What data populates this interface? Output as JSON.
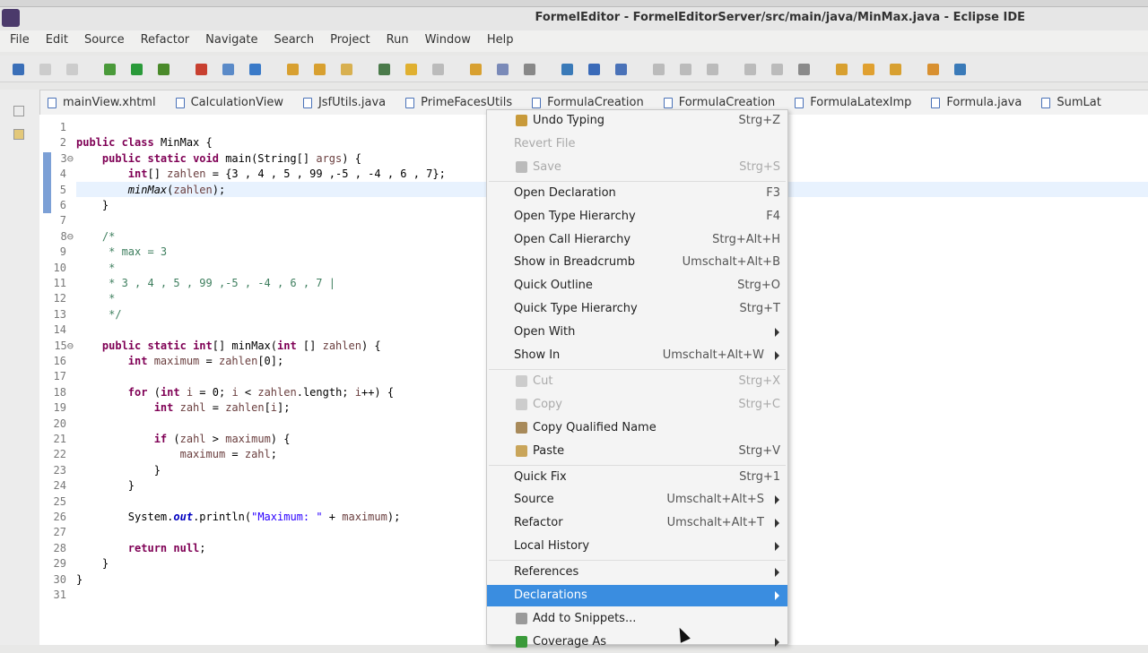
{
  "window": {
    "title": "FormelEditor - FormelEditorServer/src/main/java/MinMax.java - Eclipse IDE"
  },
  "menubar": [
    "File",
    "Edit",
    "Source",
    "Refactor",
    "Navigate",
    "Search",
    "Project",
    "Run",
    "Window",
    "Help"
  ],
  "tabs": [
    "mainView.xhtml",
    "CalculationView",
    "JsfUtils.java",
    "PrimeFacesUtils",
    "FormulaCreation",
    "FormulaCreation",
    "FormulaLatexImp",
    "Formula.java",
    "SumLat"
  ],
  "code": [
    [],
    [
      [
        "kw",
        "public "
      ],
      [
        "kw",
        "class "
      ],
      [
        "",
        "MinMax {"
      ]
    ],
    [
      [
        "",
        "    "
      ],
      [
        "kw",
        "public "
      ],
      [
        "kw",
        "static "
      ],
      [
        "kw",
        "void "
      ],
      [
        "",
        "main(String[] "
      ],
      [
        "var",
        "args"
      ],
      [
        "",
        ") {"
      ]
    ],
    [
      [
        "",
        "        "
      ],
      [
        "kw",
        "int"
      ],
      [
        "",
        "[] "
      ],
      [
        "var",
        "zahlen"
      ],
      [
        "",
        " = {3 , 4 , 5 , 99 ,-5 , -4 , 6 , 7};"
      ]
    ],
    [
      [
        "",
        "        "
      ],
      [
        "it",
        "minMax"
      ],
      [
        "",
        "("
      ],
      [
        "var",
        "zahlen"
      ],
      [
        "",
        ");"
      ]
    ],
    [
      [
        "",
        "    }"
      ]
    ],
    [],
    [
      [
        "cm",
        "    /*"
      ]
    ],
    [
      [
        "cm",
        "     * max = 3"
      ]
    ],
    [
      [
        "cm",
        "     *"
      ]
    ],
    [
      [
        "cm",
        "     * 3 , 4 , 5 , 99 ,-5 , -4 , 6 , 7 |"
      ]
    ],
    [
      [
        "cm",
        "     *"
      ]
    ],
    [
      [
        "cm",
        "     */"
      ]
    ],
    [],
    [
      [
        "",
        "    "
      ],
      [
        "kw",
        "public "
      ],
      [
        "kw",
        "static "
      ],
      [
        "kw",
        "int"
      ],
      [
        "",
        "[] minMax("
      ],
      [
        "kw",
        "int "
      ],
      [
        "",
        "[] "
      ],
      [
        "var",
        "zahlen"
      ],
      [
        "",
        ") {"
      ]
    ],
    [
      [
        "",
        "        "
      ],
      [
        "kw",
        "int "
      ],
      [
        "var",
        "maximum"
      ],
      [
        "",
        " = "
      ],
      [
        "var",
        "zahlen"
      ],
      [
        "",
        "[0];"
      ]
    ],
    [],
    [
      [
        "",
        "        "
      ],
      [
        "kw",
        "for "
      ],
      [
        "",
        "("
      ],
      [
        "kw",
        "int "
      ],
      [
        "var",
        "i"
      ],
      [
        "",
        " = 0; "
      ],
      [
        "var",
        "i"
      ],
      [
        "",
        " < "
      ],
      [
        "var",
        "zahlen"
      ],
      [
        "",
        ".length; "
      ],
      [
        "var",
        "i"
      ],
      [
        "",
        "++) {"
      ]
    ],
    [
      [
        "",
        "            "
      ],
      [
        "kw",
        "int "
      ],
      [
        "var",
        "zahl"
      ],
      [
        "",
        " = "
      ],
      [
        "var",
        "zahlen"
      ],
      [
        "",
        "["
      ],
      [
        "var",
        "i"
      ],
      [
        "",
        "];"
      ]
    ],
    [],
    [
      [
        "",
        "            "
      ],
      [
        "kw",
        "if "
      ],
      [
        "",
        "("
      ],
      [
        "var",
        "zahl"
      ],
      [
        "",
        " > "
      ],
      [
        "var",
        "maximum"
      ],
      [
        "",
        ") {"
      ]
    ],
    [
      [
        "",
        "                "
      ],
      [
        "var",
        "maximum"
      ],
      [
        "",
        " = "
      ],
      [
        "var",
        "zahl"
      ],
      [
        "",
        ";"
      ]
    ],
    [
      [
        "",
        "            }"
      ]
    ],
    [
      [
        "",
        "        }"
      ]
    ],
    [],
    [
      [
        "",
        "        System."
      ],
      [
        "fld",
        "out"
      ],
      [
        "",
        ".println("
      ],
      [
        "st",
        "\"Maximum: \""
      ],
      [
        "",
        " + "
      ],
      [
        "var",
        "maximum"
      ],
      [
        "",
        ");"
      ]
    ],
    [],
    [
      [
        "",
        "        "
      ],
      [
        "kw",
        "return "
      ],
      [
        "kw",
        "null"
      ],
      [
        "",
        ";"
      ]
    ],
    [
      [
        "",
        "    }"
      ]
    ],
    [
      [
        "",
        "}"
      ]
    ],
    []
  ],
  "context_menu": [
    {
      "label": "Undo Typing",
      "shortcut": "Strg+Z",
      "icon": "undo-icon",
      "color": "#c89a3a"
    },
    {
      "label": "Revert File",
      "disabled": true
    },
    {
      "label": "Save",
      "shortcut": "Strg+S",
      "disabled": true,
      "icon": "save-icon",
      "color": "#bbbbbb"
    },
    {
      "sep": true
    },
    {
      "label": "Open Declaration",
      "shortcut": "F3"
    },
    {
      "label": "Open Type Hierarchy",
      "shortcut": "F4"
    },
    {
      "label": "Open Call Hierarchy",
      "shortcut": "Strg+Alt+H"
    },
    {
      "label": "Show in Breadcrumb",
      "shortcut": "Umschalt+Alt+B"
    },
    {
      "label": "Quick Outline",
      "shortcut": "Strg+O"
    },
    {
      "label": "Quick Type Hierarchy",
      "shortcut": "Strg+T"
    },
    {
      "label": "Open With",
      "submenu": true
    },
    {
      "label": "Show In",
      "shortcut": "Umschalt+Alt+W",
      "submenu": true
    },
    {
      "sep": true
    },
    {
      "label": "Cut",
      "shortcut": "Strg+X",
      "disabled": true,
      "icon": "cut-icon",
      "color": "#cccccc"
    },
    {
      "label": "Copy",
      "shortcut": "Strg+C",
      "disabled": true,
      "icon": "copy-icon",
      "color": "#cccccc"
    },
    {
      "label": "Copy Qualified Name",
      "icon": "copy-qualified-name-icon",
      "color": "#a88a5a"
    },
    {
      "label": "Paste",
      "shortcut": "Strg+V",
      "icon": "paste-icon",
      "color": "#c9a55a"
    },
    {
      "sep": true
    },
    {
      "label": "Quick Fix",
      "shortcut": "Strg+1"
    },
    {
      "label": "Source",
      "shortcut": "Umschalt+Alt+S",
      "submenu": true
    },
    {
      "label": "Refactor",
      "shortcut": "Umschalt+Alt+T",
      "submenu": true
    },
    {
      "label": "Local History",
      "submenu": true
    },
    {
      "sep": true
    },
    {
      "label": "References",
      "submenu": true
    },
    {
      "label": "Declarations",
      "submenu": true,
      "selected": true
    },
    {
      "label": "Add to Snippets...",
      "icon": "snippets-icon",
      "color": "#9a9a9a"
    },
    {
      "label": "Coverage As",
      "submenu": true,
      "icon": "coverage-icon",
      "color": "#3a9a3a"
    }
  ]
}
